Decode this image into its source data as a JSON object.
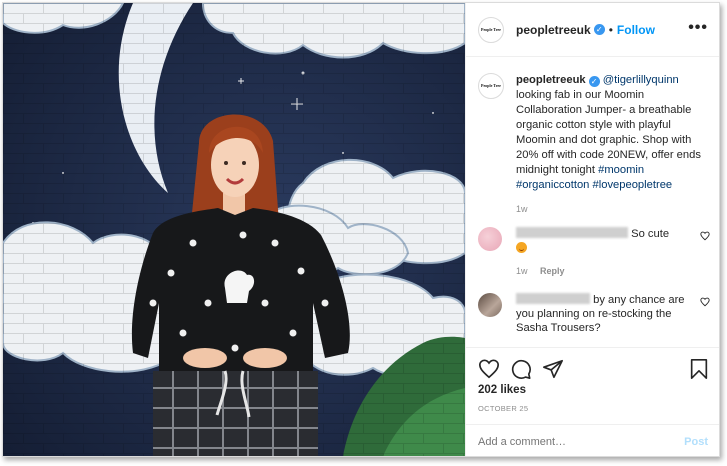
{
  "post": {
    "username": "peopletreeuk",
    "follow_label": "Follow",
    "dot": "•",
    "more_label": "•••",
    "logo_text": "People Tree",
    "verified_glyph": "✓"
  },
  "caption": {
    "username": "peopletreeuk",
    "mention": "@tigerlillyquinn",
    "body": "looking fab in our Moomin Collaboration Jumper- a breathable organic cotton style with playful Moomin and dot graphic. Shop with 20% off with code 20NEW, offer ends midnight tonight",
    "hashtags": [
      "#moomin",
      "#organiccotton",
      "#lovepeopletree"
    ],
    "time": "1w"
  },
  "comments": [
    {
      "text": "So cute",
      "time": "1w",
      "reply_label": "Reply",
      "has_emoji": true
    },
    {
      "text": "by any chance are you planning on re-stocking the Sasha Trousers?"
    }
  ],
  "footer": {
    "likes": "202 likes",
    "date": "OCTOBER 25",
    "add_comment_placeholder": "Add a comment…",
    "post_label": "Post"
  },
  "colors": {
    "accent": "#0095f6",
    "verified": "#3897f0",
    "muted": "#8e8e8e",
    "link": "#00376b"
  },
  "icons": [
    "heart-icon",
    "comment-icon",
    "share-icon",
    "bookmark-icon",
    "verified-icon",
    "more-icon"
  ]
}
